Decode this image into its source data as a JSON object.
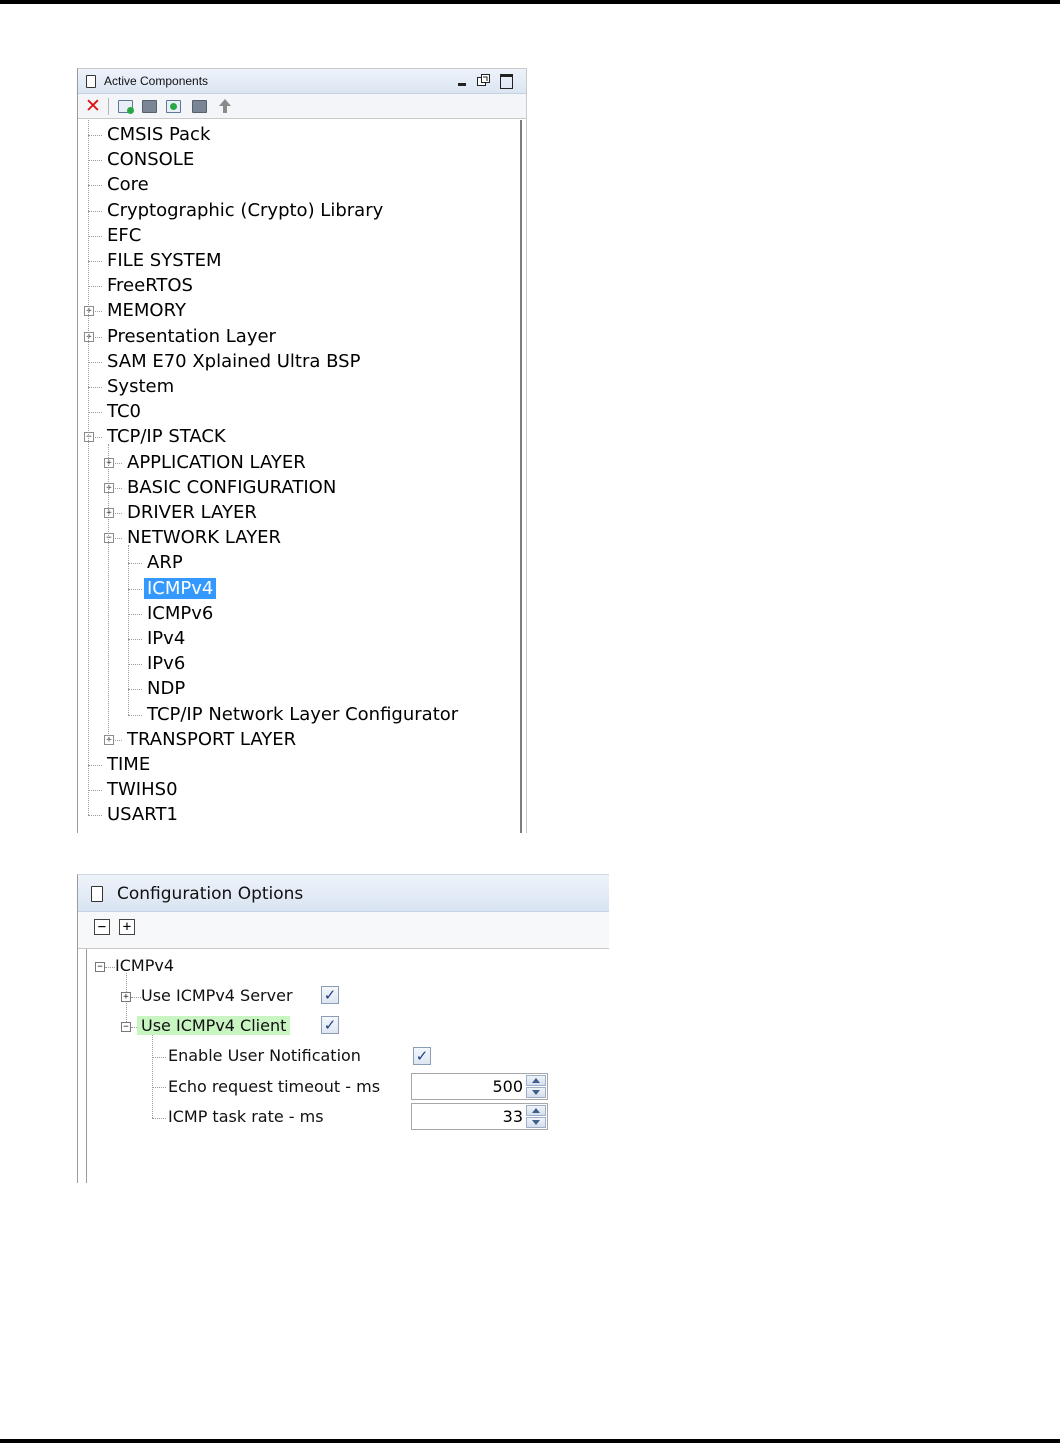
{
  "active_components": {
    "title": "Active Components",
    "toolbar_icons": [
      "remove-component-icon",
      "add-component-icon",
      "component-icon",
      "connect-component-icon",
      "component-icon-2",
      "move-up-icon"
    ],
    "tree": [
      {
        "label": "CMSIS Pack"
      },
      {
        "label": "CONSOLE"
      },
      {
        "label": "Core"
      },
      {
        "label": "Cryptographic (Crypto) Library"
      },
      {
        "label": "EFC"
      },
      {
        "label": "FILE SYSTEM"
      },
      {
        "label": "FreeRTOS"
      },
      {
        "label": "MEMORY",
        "expander": "+"
      },
      {
        "label": "Presentation Layer",
        "expander": "+"
      },
      {
        "label": "SAM E70 Xplained Ultra BSP"
      },
      {
        "label": "System"
      },
      {
        "label": "TC0"
      },
      {
        "label": "TCP/IP STACK",
        "expander": "-"
      },
      {
        "label": "APPLICATION LAYER",
        "expander": "+"
      },
      {
        "label": "BASIC CONFIGURATION",
        "expander": "+"
      },
      {
        "label": "DRIVER LAYER",
        "expander": "+"
      },
      {
        "label": "NETWORK LAYER",
        "expander": "-"
      },
      {
        "label": "ARP"
      },
      {
        "label": "ICMPv4",
        "selected": true
      },
      {
        "label": "ICMPv6"
      },
      {
        "label": "IPv4"
      },
      {
        "label": "IPv6"
      },
      {
        "label": "NDP"
      },
      {
        "label": "TCP/IP Network Layer Configurator"
      },
      {
        "label": "TRANSPORT LAYER",
        "expander": "+"
      },
      {
        "label": "TIME"
      },
      {
        "label": "TWIHS0"
      },
      {
        "label": "USART1"
      }
    ]
  },
  "configuration_options": {
    "title": "Configuration Options",
    "collapse_all": "−",
    "expand_all": "+",
    "root": "ICMPv4",
    "use_server": {
      "label": "Use ICMPv4 Server",
      "checked": "✓"
    },
    "use_client": {
      "label": "Use ICMPv4 Client",
      "checked": "✓"
    },
    "enable_notification": {
      "label": "Enable User Notification",
      "checked": "✓"
    },
    "echo_timeout": {
      "label": "Echo request timeout - ms",
      "value": "500"
    },
    "task_rate": {
      "label": "ICMP task rate - ms",
      "value": "33"
    }
  },
  "colors": {
    "selection": "#3399ff",
    "highlight": "#c9f5c3",
    "close_icon": "#dd1111"
  }
}
